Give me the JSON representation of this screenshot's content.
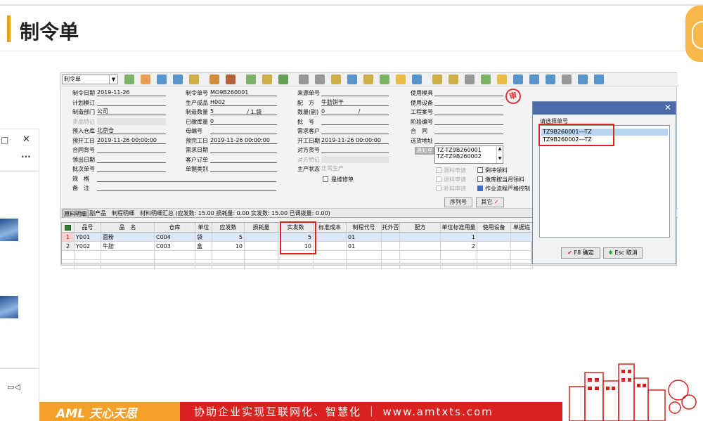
{
  "slide": {
    "title": "制令单",
    "footer_logo": "AML 天心天思",
    "footer_slogan": "协助企业实现互联网化、智慧化 ｜ www.amtxts.com"
  },
  "colors": {
    "accent": "#f0a020",
    "footer_red": "#d9211f",
    "footer_orange": "#f3a127",
    "dialog_title": "#4a6aa8",
    "highlight_red": "#e02020"
  },
  "side_panel": {
    "restore_icon": "□",
    "close_icon": "✕",
    "more_icon": "···",
    "camera_icon": "▭◁"
  },
  "toolbar": {
    "doc_type": "制令单"
  },
  "form": {
    "col1": [
      {
        "label": "制令日期",
        "value": "2019-11-26"
      },
      {
        "label": "计划模订",
        "value": ""
      },
      {
        "label": "制造部门",
        "value": "公司"
      },
      {
        "label": "货品特征",
        "value": ""
      },
      {
        "label": "预入仓库",
        "value": "北京仓"
      },
      {
        "label": "预开工日",
        "value": "2019-11-26 00:00:00"
      },
      {
        "label": "合同背号",
        "value": ""
      },
      {
        "label": "领出日期",
        "value": ""
      },
      {
        "label": "批次单号",
        "value": ""
      },
      {
        "label": "规　格",
        "value": ""
      },
      {
        "label": "备　注",
        "value": ""
      }
    ],
    "col2": [
      {
        "label": "制令单号",
        "value": "MO9B260001"
      },
      {
        "label": "生产成品",
        "value": "H002"
      },
      {
        "label": "制造数量",
        "value": "5",
        "unit": "/ 1.袋"
      },
      {
        "label": "已缴库量",
        "value": "0"
      },
      {
        "label": "母编号",
        "value": ""
      },
      {
        "label": "预完工日",
        "value": "2019-11-26 00:00:00"
      },
      {
        "label": "需求日期",
        "value": ""
      },
      {
        "label": "客户订单",
        "value": ""
      },
      {
        "label": "单据类别",
        "value": ""
      }
    ],
    "col3": [
      {
        "label": "来源单号",
        "value": ""
      },
      {
        "label": "配　方",
        "value": "牛肪饼干"
      },
      {
        "label": "数量(副)",
        "value": "0",
        "unit": "/"
      },
      {
        "label": "批　号",
        "value": ""
      },
      {
        "label": "需求客户",
        "value": ""
      },
      {
        "label": "开工日期",
        "value": "2019-11-26 00:00:00"
      },
      {
        "label": "对方货号",
        "value": ""
      },
      {
        "label": "对方特征",
        "value": ""
      },
      {
        "label": "主产状态",
        "value": "正常生产"
      }
    ],
    "repair_label": "是维修单",
    "col4": [
      {
        "label": "使用模具",
        "value": ""
      },
      {
        "label": "使用设备",
        "value": ""
      },
      {
        "label": "工程案号",
        "value": ""
      },
      {
        "label": "阶段编号",
        "value": ""
      },
      {
        "label": "合　同",
        "value": ""
      },
      {
        "label": "送货地址",
        "value": ""
      }
    ],
    "notify_label": "通知单",
    "notify_list": [
      "TZ-TZ9B260001",
      "TZ-TZ9B260002"
    ],
    "checks": [
      {
        "label": "领料申请",
        "gray": true
      },
      {
        "label": "退料申请",
        "gray": true
      },
      {
        "label": "补料申请",
        "gray": true
      },
      {
        "label": "倒冲领料",
        "gray": false
      },
      {
        "label": "缴库按当月领料",
        "gray": false
      },
      {
        "label": "作业流程严格控制",
        "gray": false,
        "checked": true
      }
    ],
    "stamp": "审",
    "serial_button": "序列号",
    "other_button": "其它"
  },
  "tabs": [
    "原料明细",
    "副产品",
    "制程明细",
    "材料明细汇总 (应发数: 15.00 损耗量: 0.00 实发数: 15.00 已调拨量: 0.00)"
  ],
  "grid": {
    "headers": [
      "品号",
      "品　名",
      "仓库",
      "单位",
      "应发数",
      "损耗量",
      "实发数",
      "标准成本",
      "制程代号",
      "托外否",
      "配方",
      "单位标准用量",
      "使用设备",
      "单据追"
    ],
    "rows": [
      {
        "idx": "1",
        "code": "Y001",
        "name": "面粉",
        "wh": "C004",
        "unit": "袋",
        "qty": "5",
        "loss": "",
        "actual": "5",
        "cost": "",
        "proc": "01",
        "out": "",
        "recipe": "",
        "std": "1",
        "equip": "",
        "trace": ""
      },
      {
        "idx": "2",
        "code": "Y002",
        "name": "牛肪",
        "wh": "C003",
        "unit": "盒",
        "qty": "10",
        "loss": "",
        "actual": "10",
        "cost": "",
        "proc": "01",
        "out": "",
        "recipe": "",
        "std": "2",
        "equip": "",
        "trace": ""
      }
    ]
  },
  "dialog": {
    "label": "请选择单号",
    "items": [
      "TZ9B260001---TZ",
      "TZ9B260002---TZ"
    ],
    "ok_label": "F8 确定",
    "cancel_label": "Esc 取消",
    "close_icon": "✕"
  }
}
